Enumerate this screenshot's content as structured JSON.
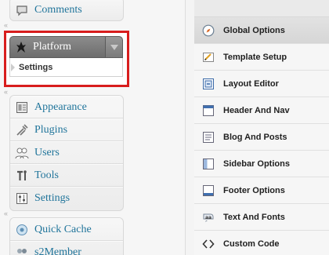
{
  "admin_menu": {
    "comments_label": "Comments",
    "platform": {
      "label": "Platform",
      "submenu_label": "Settings"
    },
    "items": [
      {
        "label": "Appearance",
        "icon": "appearance-icon"
      },
      {
        "label": "Plugins",
        "icon": "plugins-icon"
      },
      {
        "label": "Users",
        "icon": "users-icon"
      },
      {
        "label": "Tools",
        "icon": "tools-icon"
      },
      {
        "label": "Settings",
        "icon": "settings-icon"
      }
    ],
    "extra_items": [
      {
        "label": "Quick Cache",
        "icon": "quick-cache-icon"
      },
      {
        "label": "s2Member",
        "icon": "s2member-icon"
      }
    ],
    "link_color": "#21759b",
    "highlight_color": "#d81d1d"
  },
  "options_panel": {
    "items": [
      {
        "label": "Global Options",
        "icon": "compass-icon",
        "active": true
      },
      {
        "label": "Template Setup",
        "icon": "template-icon"
      },
      {
        "label": "Layout Editor",
        "icon": "layout-icon"
      },
      {
        "label": "Header And Nav",
        "icon": "header-icon"
      },
      {
        "label": "Blog And Posts",
        "icon": "blog-icon"
      },
      {
        "label": "Sidebar Options",
        "icon": "sidebar-icon"
      },
      {
        "label": "Footer Options",
        "icon": "footer-icon"
      },
      {
        "label": "Text And Fonts",
        "icon": "text-icon"
      },
      {
        "label": "Custom Code",
        "icon": "code-icon"
      }
    ]
  }
}
